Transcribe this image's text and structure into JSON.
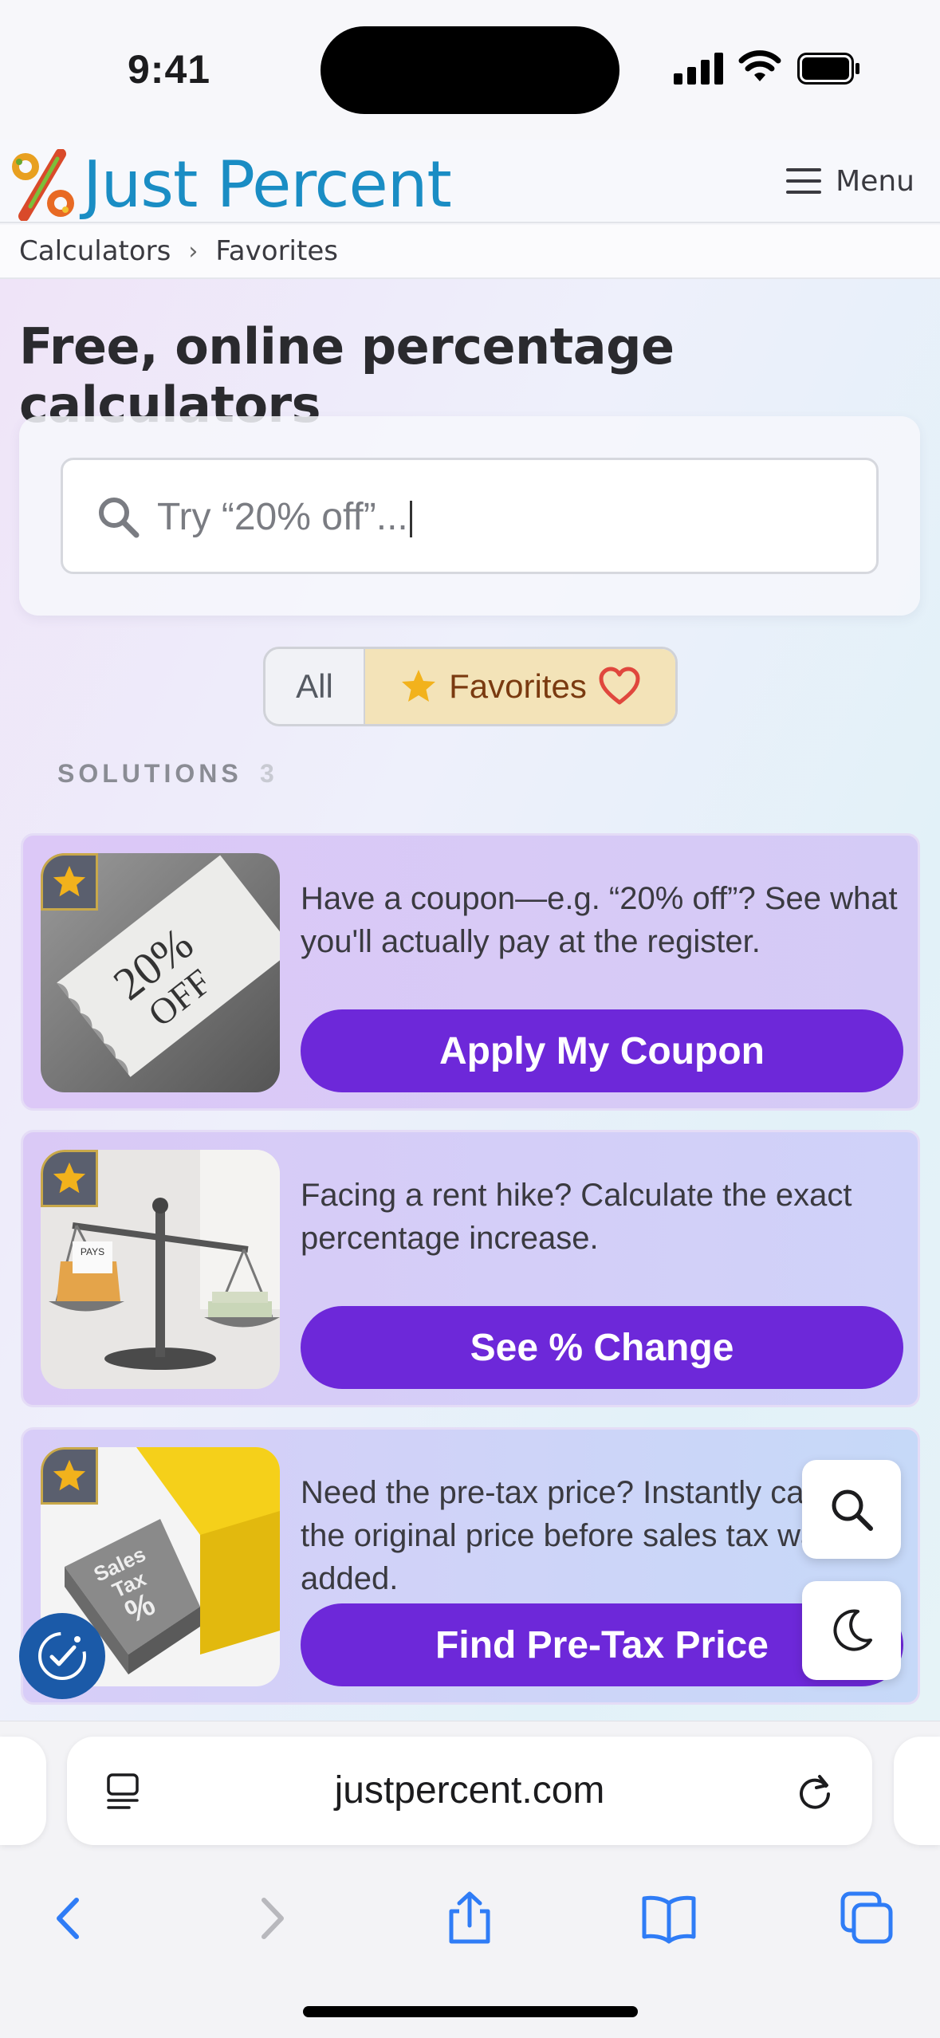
{
  "status_bar": {
    "time": "9:41"
  },
  "header": {
    "site_name": "Just Percent",
    "menu_label": "Menu"
  },
  "breadcrumb": {
    "items": [
      "Calculators",
      "Favorites"
    ],
    "separator": "›"
  },
  "page": {
    "title": "Free, online percentage calculators"
  },
  "search": {
    "placeholder": "Try “20% off”..."
  },
  "filters": {
    "all_label": "All",
    "favorites_label": "Favorites",
    "active": "Favorites"
  },
  "solutions": {
    "label": "SOLUTIONS",
    "count": "3"
  },
  "cards": [
    {
      "image_text": "20% OFF",
      "description": "Have a coupon—e.g. “20% off”? See what you'll actually pay at the register.",
      "button_label": "Apply My Coupon",
      "favorited": true
    },
    {
      "image_text": "PAYS",
      "description": "Facing a rent hike? Calculate the exact percentage increase.",
      "button_label": "See % Change",
      "favorited": true
    },
    {
      "image_text": "Sales Tax %",
      "description": "Need the pre-tax price? Instantly calculate the original price before sales tax was added.",
      "button_label": "Find Pre-Tax Price",
      "favorited": true
    }
  ],
  "browser": {
    "url": "justpercent.com"
  },
  "colors": {
    "brand_blue": "#1a8dc4",
    "button_purple": "#6d28d9",
    "favorites_bg": "#f3e3b8",
    "safari_blue": "#2f7cf6"
  }
}
